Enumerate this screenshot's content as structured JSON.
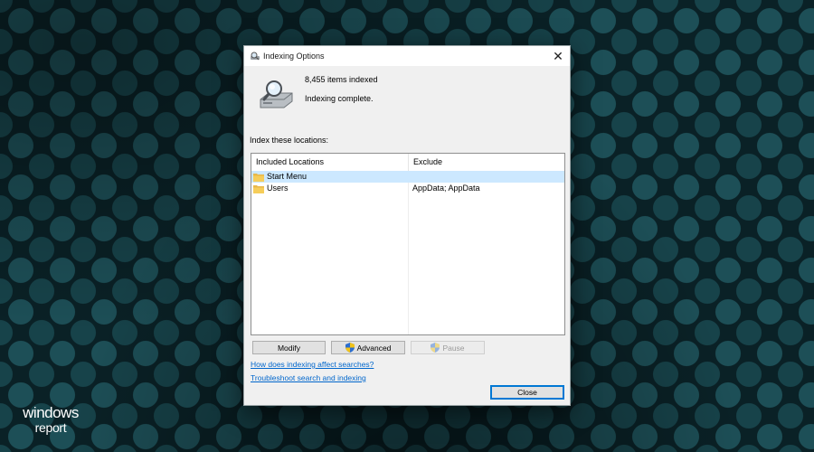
{
  "brand": {
    "line1": "windows",
    "line2": "report"
  },
  "dialog": {
    "title": "Indexing Options",
    "items_indexed": "8,455 items indexed",
    "status": "Indexing complete.",
    "index_label": "Index these locations:"
  },
  "locations": {
    "columns": [
      "Included Locations",
      "Exclude"
    ],
    "rows": [
      {
        "location": "Start Menu",
        "exclude": "",
        "selected": true
      },
      {
        "location": "Users",
        "exclude": "AppData; AppData",
        "selected": false
      }
    ]
  },
  "buttons": {
    "modify": "Modify",
    "advanced": "Advanced",
    "pause": "Pause",
    "close": "Close"
  },
  "links": {
    "how_indexing": "How does indexing affect searches?",
    "troubleshoot": "Troubleshoot search and indexing"
  },
  "icons": {
    "title": "indexing-options-icon",
    "status": "magnifier-drive-icon",
    "folder": "folder-icon",
    "shield": "uac-shield-icon",
    "close": "close-icon"
  },
  "colors": {
    "selection": "#cce8ff",
    "link": "#0066cc",
    "default_button_border": "#0078d4"
  }
}
